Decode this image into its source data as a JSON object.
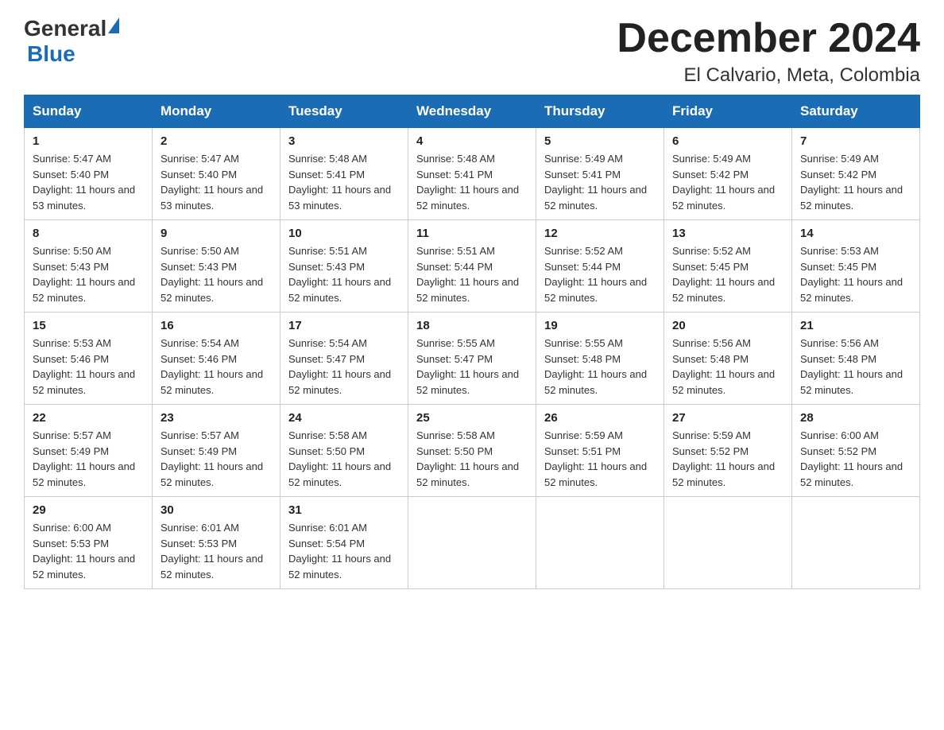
{
  "logo": {
    "general": "General",
    "blue": "Blue"
  },
  "title": {
    "month": "December 2024",
    "location": "El Calvario, Meta, Colombia"
  },
  "headers": [
    "Sunday",
    "Monday",
    "Tuesday",
    "Wednesday",
    "Thursday",
    "Friday",
    "Saturday"
  ],
  "weeks": [
    [
      {
        "day": "1",
        "sunrise": "5:47 AM",
        "sunset": "5:40 PM",
        "daylight": "11 hours and 53 minutes."
      },
      {
        "day": "2",
        "sunrise": "5:47 AM",
        "sunset": "5:40 PM",
        "daylight": "11 hours and 53 minutes."
      },
      {
        "day": "3",
        "sunrise": "5:48 AM",
        "sunset": "5:41 PM",
        "daylight": "11 hours and 53 minutes."
      },
      {
        "day": "4",
        "sunrise": "5:48 AM",
        "sunset": "5:41 PM",
        "daylight": "11 hours and 52 minutes."
      },
      {
        "day": "5",
        "sunrise": "5:49 AM",
        "sunset": "5:41 PM",
        "daylight": "11 hours and 52 minutes."
      },
      {
        "day": "6",
        "sunrise": "5:49 AM",
        "sunset": "5:42 PM",
        "daylight": "11 hours and 52 minutes."
      },
      {
        "day": "7",
        "sunrise": "5:49 AM",
        "sunset": "5:42 PM",
        "daylight": "11 hours and 52 minutes."
      }
    ],
    [
      {
        "day": "8",
        "sunrise": "5:50 AM",
        "sunset": "5:43 PM",
        "daylight": "11 hours and 52 minutes."
      },
      {
        "day": "9",
        "sunrise": "5:50 AM",
        "sunset": "5:43 PM",
        "daylight": "11 hours and 52 minutes."
      },
      {
        "day": "10",
        "sunrise": "5:51 AM",
        "sunset": "5:43 PM",
        "daylight": "11 hours and 52 minutes."
      },
      {
        "day": "11",
        "sunrise": "5:51 AM",
        "sunset": "5:44 PM",
        "daylight": "11 hours and 52 minutes."
      },
      {
        "day": "12",
        "sunrise": "5:52 AM",
        "sunset": "5:44 PM",
        "daylight": "11 hours and 52 minutes."
      },
      {
        "day": "13",
        "sunrise": "5:52 AM",
        "sunset": "5:45 PM",
        "daylight": "11 hours and 52 minutes."
      },
      {
        "day": "14",
        "sunrise": "5:53 AM",
        "sunset": "5:45 PM",
        "daylight": "11 hours and 52 minutes."
      }
    ],
    [
      {
        "day": "15",
        "sunrise": "5:53 AM",
        "sunset": "5:46 PM",
        "daylight": "11 hours and 52 minutes."
      },
      {
        "day": "16",
        "sunrise": "5:54 AM",
        "sunset": "5:46 PM",
        "daylight": "11 hours and 52 minutes."
      },
      {
        "day": "17",
        "sunrise": "5:54 AM",
        "sunset": "5:47 PM",
        "daylight": "11 hours and 52 minutes."
      },
      {
        "day": "18",
        "sunrise": "5:55 AM",
        "sunset": "5:47 PM",
        "daylight": "11 hours and 52 minutes."
      },
      {
        "day": "19",
        "sunrise": "5:55 AM",
        "sunset": "5:48 PM",
        "daylight": "11 hours and 52 minutes."
      },
      {
        "day": "20",
        "sunrise": "5:56 AM",
        "sunset": "5:48 PM",
        "daylight": "11 hours and 52 minutes."
      },
      {
        "day": "21",
        "sunrise": "5:56 AM",
        "sunset": "5:48 PM",
        "daylight": "11 hours and 52 minutes."
      }
    ],
    [
      {
        "day": "22",
        "sunrise": "5:57 AM",
        "sunset": "5:49 PM",
        "daylight": "11 hours and 52 minutes."
      },
      {
        "day": "23",
        "sunrise": "5:57 AM",
        "sunset": "5:49 PM",
        "daylight": "11 hours and 52 minutes."
      },
      {
        "day": "24",
        "sunrise": "5:58 AM",
        "sunset": "5:50 PM",
        "daylight": "11 hours and 52 minutes."
      },
      {
        "day": "25",
        "sunrise": "5:58 AM",
        "sunset": "5:50 PM",
        "daylight": "11 hours and 52 minutes."
      },
      {
        "day": "26",
        "sunrise": "5:59 AM",
        "sunset": "5:51 PM",
        "daylight": "11 hours and 52 minutes."
      },
      {
        "day": "27",
        "sunrise": "5:59 AM",
        "sunset": "5:52 PM",
        "daylight": "11 hours and 52 minutes."
      },
      {
        "day": "28",
        "sunrise": "6:00 AM",
        "sunset": "5:52 PM",
        "daylight": "11 hours and 52 minutes."
      }
    ],
    [
      {
        "day": "29",
        "sunrise": "6:00 AM",
        "sunset": "5:53 PM",
        "daylight": "11 hours and 52 minutes."
      },
      {
        "day": "30",
        "sunrise": "6:01 AM",
        "sunset": "5:53 PM",
        "daylight": "11 hours and 52 minutes."
      },
      {
        "day": "31",
        "sunrise": "6:01 AM",
        "sunset": "5:54 PM",
        "daylight": "11 hours and 52 minutes."
      },
      null,
      null,
      null,
      null
    ]
  ]
}
